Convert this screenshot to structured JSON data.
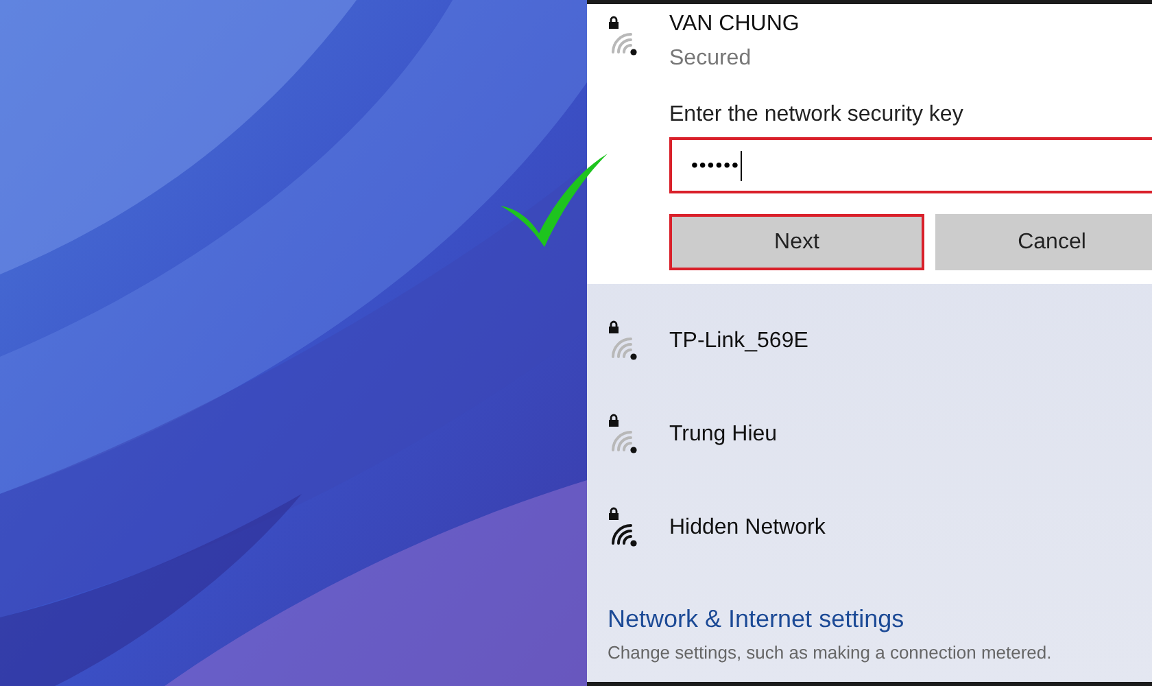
{
  "selected_network": {
    "name": "VAN CHUNG",
    "status": "Secured",
    "kind": "weak",
    "prompt": "Enter the network security key",
    "key_value": "••••••",
    "buttons": [
      {
        "label": "Next",
        "highlighted": true
      },
      {
        "label": "Cancel",
        "highlighted": false
      }
    ]
  },
  "networks": [
    {
      "name": "TP-Link_569E",
      "kind": "weak"
    },
    {
      "name": "Trung Hieu",
      "kind": "weak"
    },
    {
      "name": "Hidden Network",
      "kind": "full"
    }
  ],
  "settings_link": {
    "title": "Network & Internet settings",
    "description": "Change settings, such as making a connection metered."
  }
}
